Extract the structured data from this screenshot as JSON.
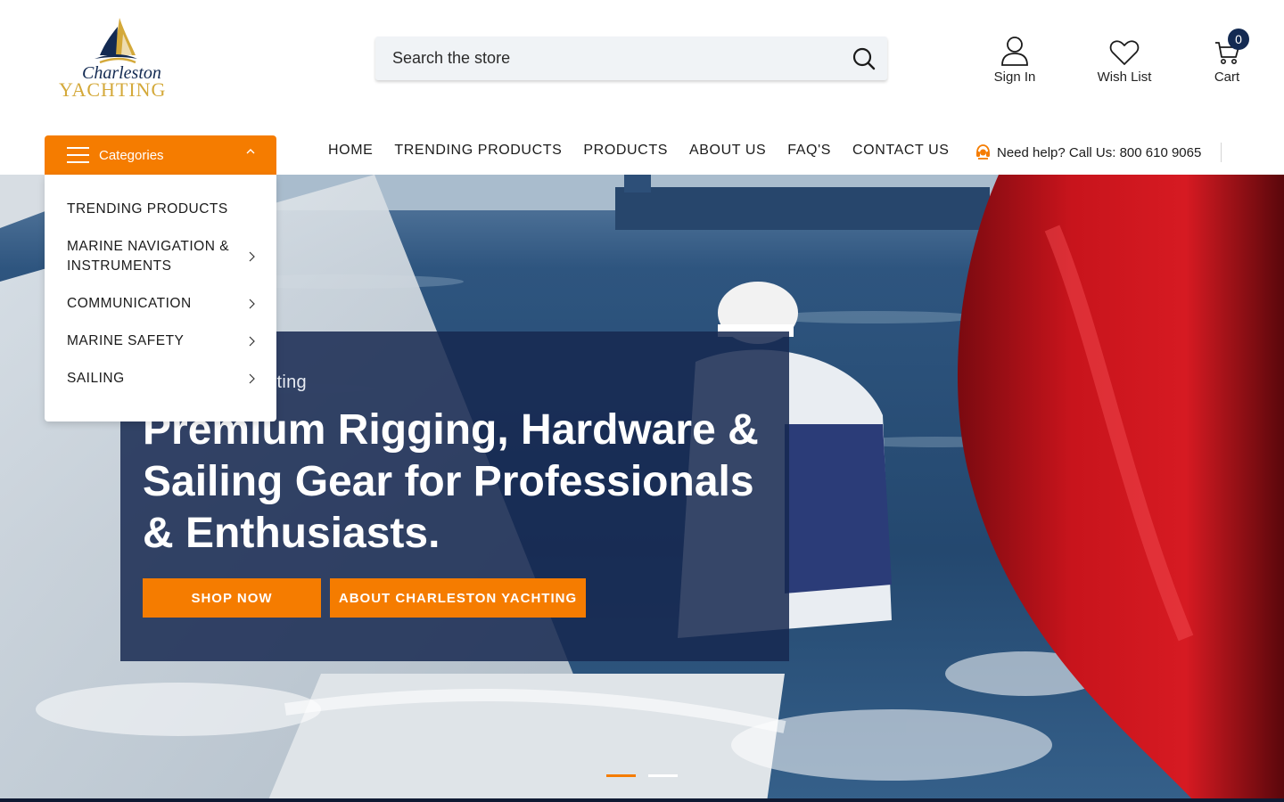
{
  "brand": {
    "logo_script": "Charleston",
    "logo_word": "YACHTING",
    "colors": {
      "accent": "#f57c00",
      "navy": "#132a52",
      "logo_gold": "#d4a93a"
    }
  },
  "search": {
    "placeholder": "Search the store",
    "value": ""
  },
  "header_actions": {
    "sign_in": "Sign In",
    "wish_list": "Wish List",
    "cart": "Cart",
    "cart_count": "0"
  },
  "categories_button": {
    "label": "Categories"
  },
  "category_menu": [
    {
      "label": "TRENDING PRODUCTS",
      "has_submenu": false
    },
    {
      "label": "MARINE NAVIGATION & INSTRUMENTS",
      "has_submenu": true
    },
    {
      "label": "COMMUNICATION",
      "has_submenu": true
    },
    {
      "label": "MARINE SAFETY",
      "has_submenu": true
    },
    {
      "label": "SAILING",
      "has_submenu": true
    }
  ],
  "nav": [
    "HOME",
    "TRENDING PRODUCTS",
    "PRODUCTS",
    "ABOUT US",
    "FAQ'S",
    "CONTACT US"
  ],
  "help": {
    "text": "Need help? Call Us: 800 610 9065"
  },
  "hero": {
    "subtitle": "Charleston Yachting",
    "title": "Premium Rigging, Hardware & Sailing Gear for Professionals & Enthusiasts.",
    "buttons": [
      "SHOP NOW",
      "ABOUT CHARLESTON YACHTING"
    ],
    "slides": 2,
    "active_slide": 1
  },
  "icons": [
    "search-icon",
    "user-icon",
    "heart-icon",
    "cart-icon",
    "hamburger-icon",
    "chevron-up-icon",
    "chevron-right-icon",
    "headset-icon"
  ]
}
